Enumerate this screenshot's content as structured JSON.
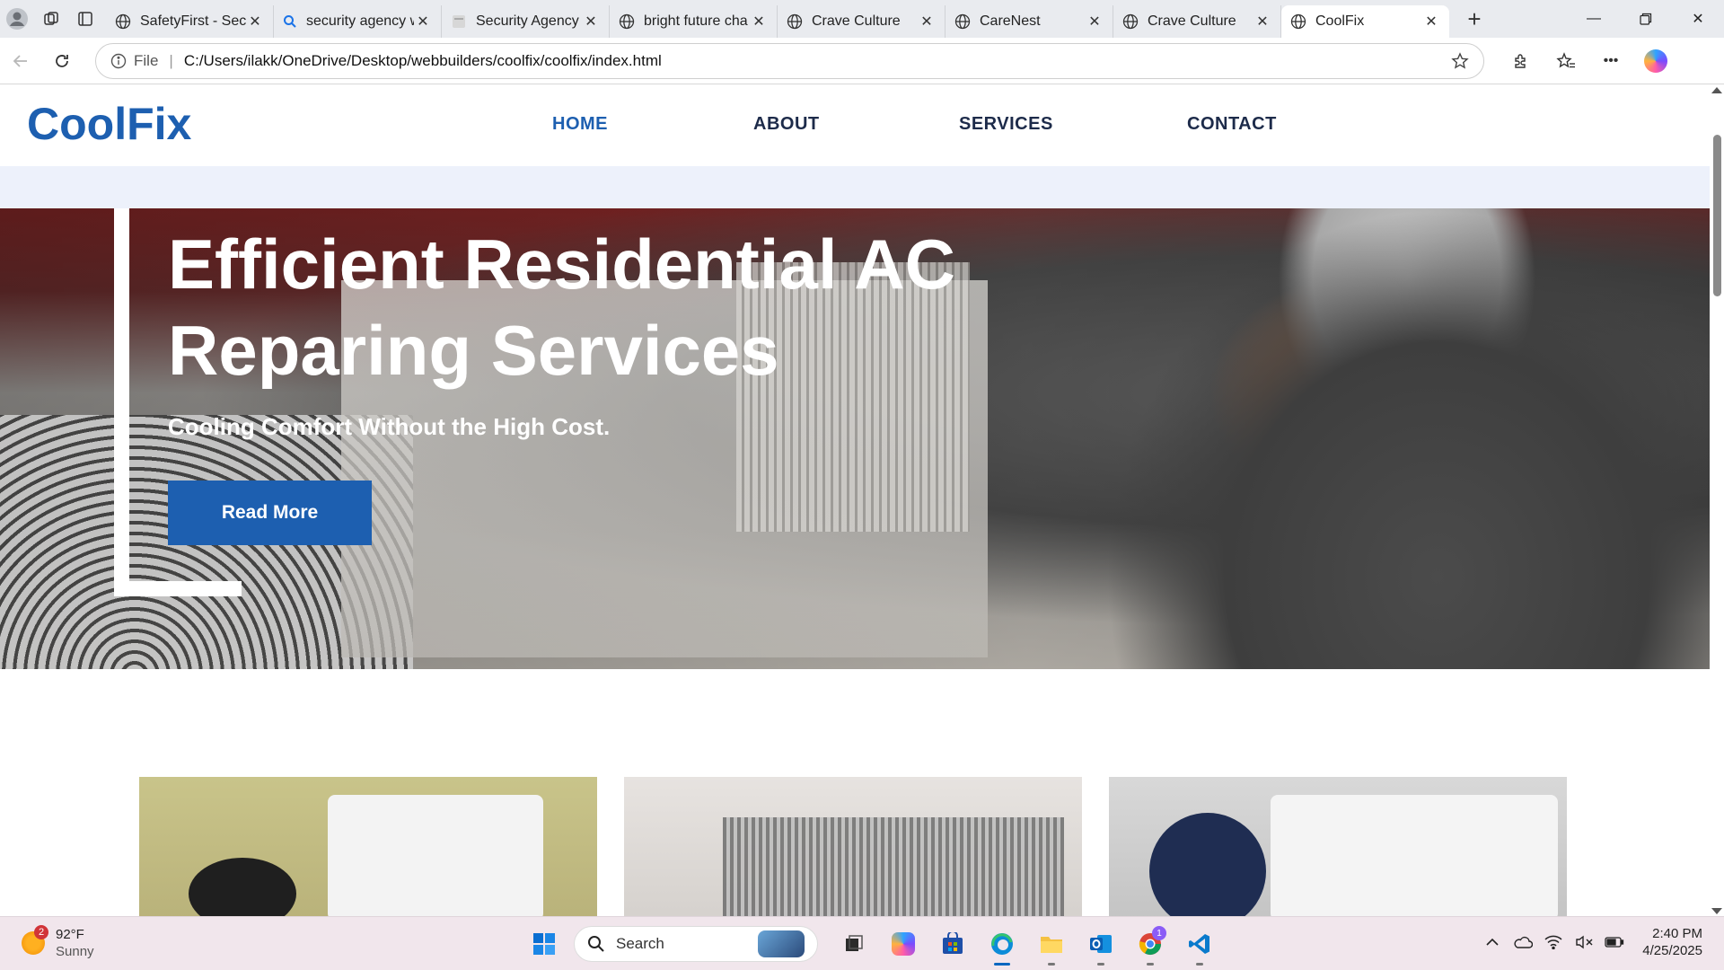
{
  "browser": {
    "tabs": [
      {
        "title": "SafetyFirst - Secu",
        "icon": "globe-icon"
      },
      {
        "title": "security agency w",
        "icon": "search-icon"
      },
      {
        "title": "Security Agency",
        "icon": "page-icon"
      },
      {
        "title": "bright future cha",
        "icon": "globe-icon"
      },
      {
        "title": "Crave Culture",
        "icon": "globe-icon"
      },
      {
        "title": "CareNest",
        "icon": "globe-icon"
      },
      {
        "title": "Crave Culture",
        "icon": "globe-icon"
      },
      {
        "title": "CoolFix",
        "icon": "globe-icon",
        "active": true
      }
    ],
    "address": {
      "scheme": "File",
      "url": "C:/Users/ilakk/OneDrive/Desktop/webbuilders/coolfix/coolfix/index.html"
    }
  },
  "site": {
    "logo": "CoolFix",
    "nav": {
      "home": "HOME",
      "about": "ABOUT",
      "services": "SERVICES",
      "contact": "CONTACT"
    },
    "hero": {
      "title": "Efficient Residential AC Reparing Services",
      "subtitle": "Cooling Comfort Without the High Cost.",
      "cta": "Read More"
    },
    "brand_color": "#1d5fb0"
  },
  "taskbar": {
    "weather": {
      "temp": "92°F",
      "condition": "Sunny",
      "badge": "2"
    },
    "search_placeholder": "Search",
    "clock": {
      "time": "2:40 PM",
      "date": "4/25/2025"
    },
    "chrome_badge": "1"
  }
}
